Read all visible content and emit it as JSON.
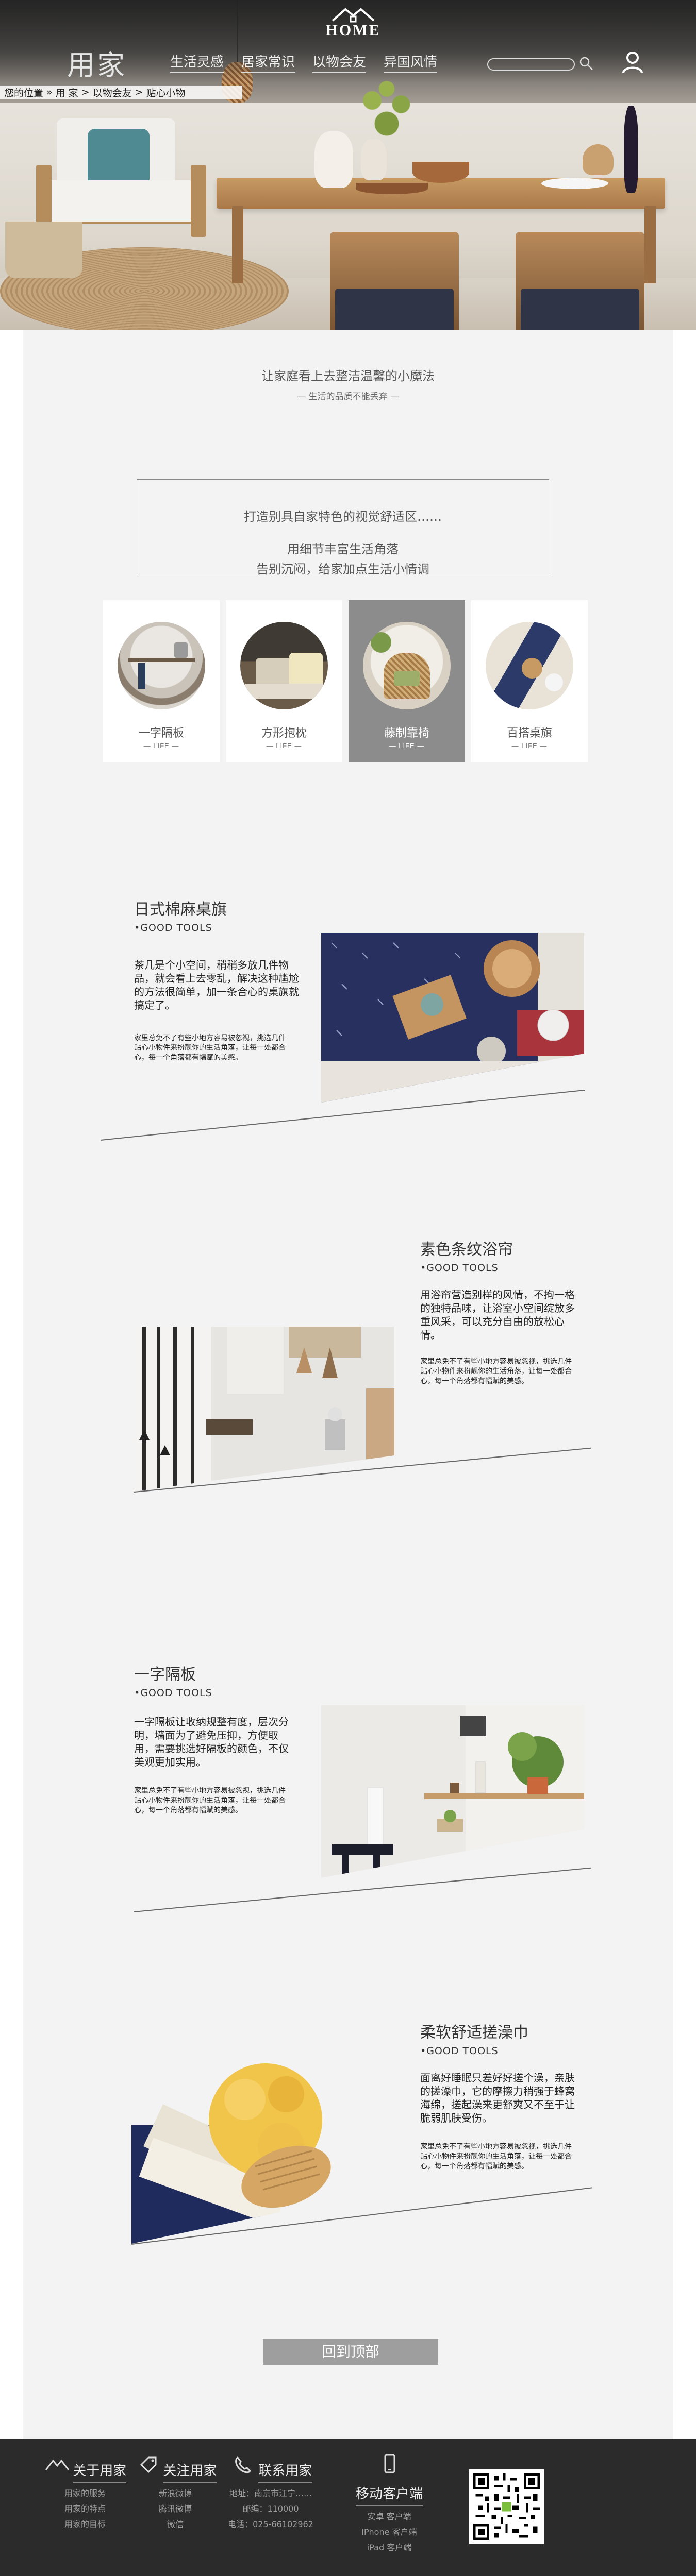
{
  "header": {
    "brand": "用家",
    "logo_text": "HOME",
    "nav": [
      "生活灵感",
      "居家常识",
      "以物会友",
      "异国风情"
    ],
    "search_placeholder": "",
    "breadcrumb": [
      "您的位置",
      "»",
      "用 家",
      ">",
      "以物会友",
      ">",
      "贴心小物"
    ]
  },
  "intro": {
    "title": "让家庭看上去整洁温馨的小魔法",
    "subtitle": "— 生活的品质不能丢弃 —"
  },
  "notice": {
    "line1": "打造别具自家特色的视觉舒适区……",
    "line2": "用细节丰富生活角落",
    "line3": "告别沉闷，给家加点生活小情调"
  },
  "categories": [
    {
      "name": "一字隔板",
      "life": "— LIFE —"
    },
    {
      "name": "方形抱枕",
      "life": "— LIFE —"
    },
    {
      "name": "藤制靠椅",
      "life": "— LIFE —",
      "active": true
    },
    {
      "name": "百搭桌旗",
      "life": "— LIFE —"
    }
  ],
  "products": [
    {
      "title": "日式棉麻桌旗",
      "en": "•GOOD  TOOLS",
      "desc": "茶几是个小空间，稍稍多放几件物品，就会看上去零乱，解决这种尴尬的方法很简单，加一条合心的桌旗就搞定了。",
      "desc2": "家里总免不了有些小地方容易被忽视，挑选几件贴心小物件来扮靓你的生活角落，让每一处都合心，每一个角落都有幅赋的美感。"
    },
    {
      "title": "素色条纹浴帘",
      "en": "•GOOD  TOOLS",
      "desc": "用浴帘营造别样的风情，不拘一格的独特品味，让浴室小空间绽放多重风采，可以充分自由的放松心情。",
      "desc2": "家里总免不了有些小地方容易被忽视，挑选几件贴心小物件来扮靓你的生活角落，让每一处都合心，每一个角落都有幅赋的美感。"
    },
    {
      "title": "一字隔板",
      "en": "•GOOD  TOOLS",
      "desc": "一字隔板让收纳规整有度，层次分明，墙面为了避免压抑，方便取用，需要挑选好隔板的颜色，不仅美观更加实用。",
      "desc2": "家里总免不了有些小地方容易被忽视，挑选几件贴心小物件来扮靓你的生活角落，让每一处都合心，每一个角落都有幅赋的美感。"
    },
    {
      "title": "柔软舒适搓澡巾",
      "en": "•GOOD  TOOLS",
      "desc": "面离好睡眠只差好好搓个澡，亲肤的搓澡巾，它的摩擦力稍强于蜂窝海绵，搓起澡来更舒爽又不至于让脆弱肌肤受伤。",
      "desc2": "家里总免不了有些小地方容易被忽视，挑选几件贴心小物件来扮靓你的生活角落，让每一处都合心，每一个角落都有幅赋的美感。"
    }
  ],
  "back_to_top": "回到顶部",
  "footer": {
    "columns": [
      {
        "icon": "house-icon",
        "title": "关于用家",
        "links": [
          "用家的服务",
          "用家的特点",
          "用家的目标"
        ]
      },
      {
        "icon": "tag-icon",
        "title": "关注用家",
        "links": [
          "新浪微博",
          "腾讯微博",
          "微信"
        ]
      },
      {
        "icon": "phone-icon",
        "title": "联系用家",
        "links": [
          "地址：南京市江宁……",
          "邮编：110000",
          "电话：025-66102962"
        ]
      },
      {
        "icon": "mobile-icon",
        "title": "移动客户端",
        "links": [
          "安卓 客户端",
          "iPhone 客户端",
          "iPad 客户端"
        ]
      }
    ]
  }
}
